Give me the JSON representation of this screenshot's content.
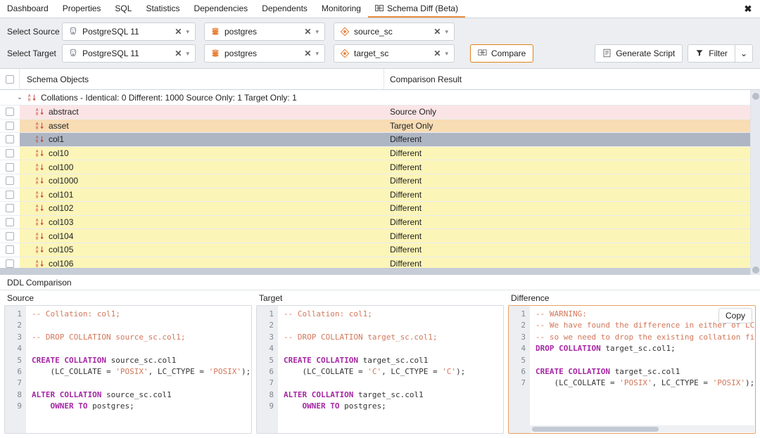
{
  "tabs": [
    {
      "label": "Dashboard",
      "active": false,
      "icon": null
    },
    {
      "label": "Properties",
      "active": false,
      "icon": null
    },
    {
      "label": "SQL",
      "active": false,
      "icon": null
    },
    {
      "label": "Statistics",
      "active": false,
      "icon": null
    },
    {
      "label": "Dependencies",
      "active": false,
      "icon": null
    },
    {
      "label": "Dependents",
      "active": false,
      "icon": null
    },
    {
      "label": "Monitoring",
      "active": false,
      "icon": null
    },
    {
      "label": "Schema Diff (Beta)",
      "active": true,
      "icon": "schema-diff-icon"
    }
  ],
  "close_label": "✖",
  "selectors": {
    "source": {
      "label": "Select Source",
      "server": {
        "value": "PostgreSQL 11",
        "icon": "postgresql-server-icon"
      },
      "database": {
        "value": "postgres",
        "icon": "database-icon"
      },
      "schema": {
        "value": "source_sc",
        "icon": "schema-icon"
      },
      "clear_label": "✕",
      "caret_label": "▾"
    },
    "target": {
      "label": "Select Target",
      "server": {
        "value": "PostgreSQL 11",
        "icon": "postgresql-server-icon"
      },
      "database": {
        "value": "postgres",
        "icon": "database-icon"
      },
      "schema": {
        "value": "target_sc",
        "icon": "schema-icon"
      },
      "clear_label": "✕",
      "caret_label": "▾"
    },
    "compare_label": "Compare",
    "generate_script_label": "Generate Script",
    "filter_label": "Filter",
    "filter_caret_label": "⌄"
  },
  "table": {
    "headers": {
      "objects": "Schema Objects",
      "result": "Comparison Result"
    },
    "group": {
      "chevron": "⌄",
      "icon": "collation-icon",
      "label": "Collations - Identical: ",
      "identical": "0",
      "different_label": " Different: ",
      "different": "1000",
      "source_only_label": " Source Only: ",
      "source_only": "1",
      "target_only_label": " Target Only: ",
      "target_only": "1",
      "text": "Collations - Identical: 0  Different: 1000  Source Only: 1  Target Only: 1"
    },
    "rows": [
      {
        "name": "abstract",
        "result": "Source Only",
        "state": "src-only",
        "selected": false
      },
      {
        "name": "asset",
        "result": "Target Only",
        "state": "tgt-only",
        "selected": false
      },
      {
        "name": "col1",
        "result": "Different",
        "state": "diff",
        "selected": true
      },
      {
        "name": "col10",
        "result": "Different",
        "state": "diff",
        "selected": false
      },
      {
        "name": "col100",
        "result": "Different",
        "state": "diff",
        "selected": false
      },
      {
        "name": "col1000",
        "result": "Different",
        "state": "diff",
        "selected": false
      },
      {
        "name": "col101",
        "result": "Different",
        "state": "diff",
        "selected": false
      },
      {
        "name": "col102",
        "result": "Different",
        "state": "diff",
        "selected": false
      },
      {
        "name": "col103",
        "result": "Different",
        "state": "diff",
        "selected": false
      },
      {
        "name": "col104",
        "result": "Different",
        "state": "diff",
        "selected": false
      },
      {
        "name": "col105",
        "result": "Different",
        "state": "diff",
        "selected": false
      },
      {
        "name": "col106",
        "result": "Different",
        "state": "diff",
        "selected": false
      }
    ]
  },
  "ddl": {
    "title": "DDL Comparison",
    "copy_label": "Copy",
    "panels": [
      {
        "label": "Source",
        "line_numbers": [
          "1",
          "2",
          "3",
          "4",
          "5",
          "6",
          "7",
          "8",
          "9"
        ],
        "lines": [
          "-- Collation: col1;",
          "",
          "-- DROP COLLATION source_sc.col1;",
          "",
          "CREATE COLLATION source_sc.col1",
          "    (LC_COLLATE = 'POSIX', LC_CTYPE = 'POSIX');",
          "",
          "ALTER COLLATION source_sc.col1",
          "    OWNER TO postgres;"
        ]
      },
      {
        "label": "Target",
        "line_numbers": [
          "1",
          "2",
          "3",
          "4",
          "5",
          "6",
          "7",
          "8",
          "9"
        ],
        "lines": [
          "-- Collation: col1;",
          "",
          "-- DROP COLLATION target_sc.col1;",
          "",
          "CREATE COLLATION target_sc.col1",
          "    (LC_COLLATE = 'C', LC_CTYPE = 'C');",
          "",
          "ALTER COLLATION target_sc.col1",
          "    OWNER TO postgres;"
        ]
      },
      {
        "label": "Difference",
        "line_numbers": [
          "1",
          "2",
          "3",
          "4",
          "5",
          "6",
          "7"
        ],
        "lines": [
          "-- WARNING:",
          "-- We have found the difference in either of LC_COLLATE",
          "-- so we need to drop the existing collation first",
          "DROP COLLATION target_sc.col1;",
          "",
          "CREATE COLLATION target_sc.col1",
          "    (LC_COLLATE = 'POSIX', LC_CTYPE = 'POSIX');"
        ]
      }
    ]
  },
  "colors": {
    "accent": "#e88d3e",
    "source_only": "#fbe4e6",
    "target_only": "#f7dcb4",
    "different": "#fcf5b8",
    "selected": "#aeb6c4",
    "keyword": "#a626a4",
    "comment": "#d2775a"
  }
}
